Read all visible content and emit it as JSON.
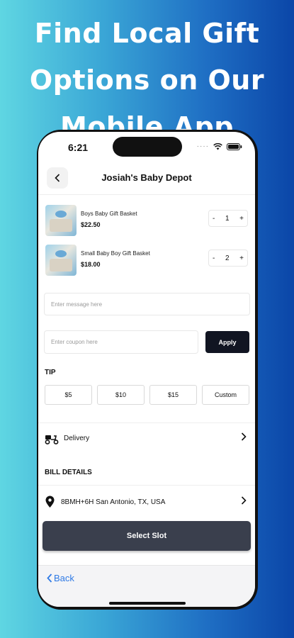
{
  "banner": {
    "lines": [
      "Find Local Gift",
      "Options on Our",
      "Mobile App"
    ]
  },
  "status_bar": {
    "time": "6:21",
    "dots": "····"
  },
  "header": {
    "title": "Josiah's Baby Depot"
  },
  "cart": {
    "items": [
      {
        "name": "Boys Baby Gift Basket",
        "price": "$22.50",
        "qty": "1"
      },
      {
        "name": "Small Baby Boy Gift Basket",
        "price": "$18.00",
        "qty": "2"
      }
    ],
    "minus": "-",
    "plus": "+"
  },
  "message": {
    "placeholder": "Enter message here"
  },
  "coupon": {
    "placeholder": "Enter coupon here",
    "apply_label": "Apply"
  },
  "tip": {
    "label": "TIP",
    "options": [
      "$5",
      "$10",
      "$15",
      "Custom"
    ]
  },
  "delivery": {
    "label": "Delivery"
  },
  "bill": {
    "label": "BILL DETAILS"
  },
  "address": {
    "text": "8BMH+6H San Antonio, TX, USA"
  },
  "slot_button": {
    "label": "Select Slot"
  },
  "footer": {
    "back_label": "Back"
  },
  "colors": {
    "accent_link": "#2f7ae5",
    "dark_button": "#111522",
    "slot_button": "#3a3f4d"
  }
}
